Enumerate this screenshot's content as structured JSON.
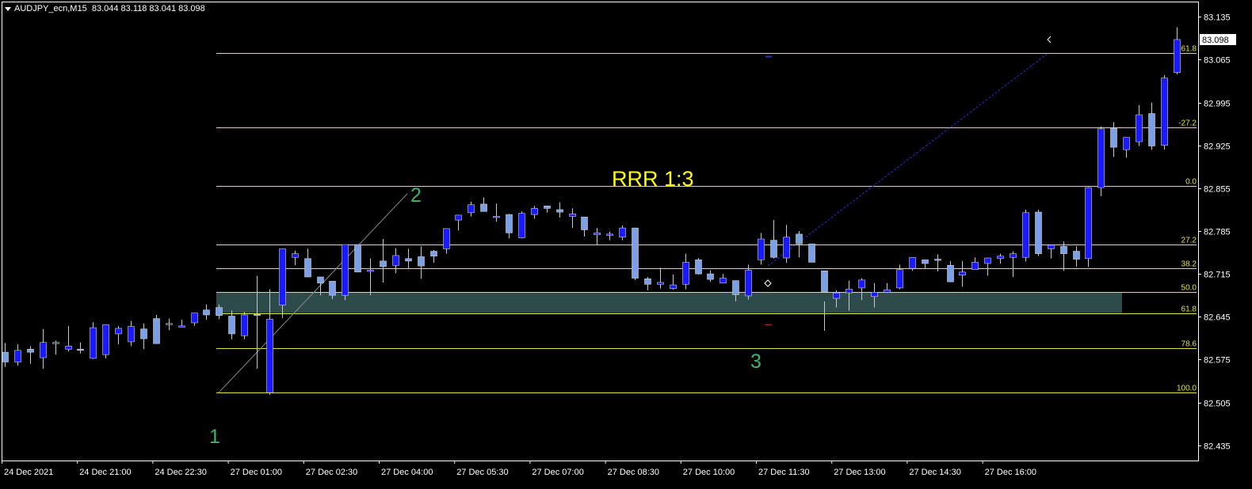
{
  "header": {
    "symbol": "AUDJPY_ecn,M15",
    "ohlc": "83.044 83.118 83.041 83.098"
  },
  "colors": {
    "background": "#000000",
    "frame": "#ffffff",
    "bull_candle": "#1a1aff",
    "bear_candle": "#7aa0e8",
    "fib_line": "#e6e632",
    "fib_label": "#e6e632",
    "zone_fill": "#2f4f4f",
    "wave_label": "#3cb371",
    "rrr_text": "#ffff00"
  },
  "annotations": {
    "rrr": "RRR 1:3",
    "wave_1": "1",
    "wave_2": "2",
    "wave_3": "3"
  },
  "chart_data": {
    "type": "candlestick",
    "symbol": "AUDJPY_ecn",
    "timeframe": "M15",
    "current_price": "83.098",
    "y_axis": {
      "ticks": [
        "83.135",
        "83.065",
        "82.995",
        "82.925",
        "82.855",
        "82.785",
        "82.715",
        "82.645",
        "82.575",
        "82.505",
        "82.435"
      ],
      "range": [
        82.41,
        83.16
      ]
    },
    "x_axis": {
      "ticks": [
        "24 Dec 2021",
        "24 Dec 21:00",
        "24 Dec 22:30",
        "27 Dec 01:00",
        "27 Dec 02:30",
        "27 Dec 04:00",
        "27 Dec 05:30",
        "27 Dec 07:00",
        "27 Dec 08:30",
        "27 Dec 10:00",
        "27 Dec 11:30",
        "27 Dec 13:00",
        "27 Dec 14:30",
        "27 Dec 16:00"
      ]
    },
    "fibonacci_levels": [
      {
        "label": "-61.8",
        "price": 83.076
      },
      {
        "label": "-27.2",
        "price": 82.955
      },
      {
        "label": "0.0",
        "price": 82.859
      },
      {
        "label": "27.2",
        "price": 82.763
      },
      {
        "label": "38.2",
        "price": 82.724
      },
      {
        "label": "50.0",
        "price": 82.685
      },
      {
        "label": "61.8",
        "price": 82.651
      },
      {
        "label": "78.6",
        "price": 82.594
      },
      {
        "label": "100.0",
        "price": 82.521
      }
    ],
    "zone": {
      "from": 82.651,
      "to": 82.685
    },
    "candles": [
      [
        82.587,
        82.602,
        82.563,
        82.571
      ],
      [
        82.571,
        82.6,
        82.565,
        82.59
      ],
      [
        82.592,
        82.597,
        82.568,
        82.587
      ],
      [
        82.578,
        82.625,
        82.56,
        82.603
      ],
      [
        82.603,
        82.606,
        82.583,
        82.603
      ],
      [
        82.592,
        82.63,
        82.588,
        82.597
      ],
      [
        82.592,
        82.603,
        82.585,
        82.59
      ],
      [
        82.577,
        82.636,
        82.576,
        82.627
      ],
      [
        82.583,
        82.631,
        82.577,
        82.632
      ],
      [
        82.617,
        82.63,
        82.6,
        82.626
      ],
      [
        82.604,
        82.638,
        82.597,
        82.629
      ],
      [
        82.625,
        82.634,
        82.592,
        82.609
      ],
      [
        82.642,
        82.648,
        82.601,
        82.601
      ],
      [
        82.634,
        82.642,
        82.623,
        82.634
      ],
      [
        82.63,
        82.64,
        82.628,
        82.63
      ],
      [
        82.635,
        82.651,
        82.63,
        82.651
      ],
      [
        82.656,
        82.665,
        82.64,
        82.648
      ],
      [
        82.66,
        82.665,
        82.641,
        82.647
      ],
      [
        82.646,
        82.655,
        82.608,
        82.617
      ],
      [
        82.614,
        82.653,
        82.608,
        82.648
      ],
      [
        82.649,
        82.712,
        82.56,
        82.648
      ],
      [
        82.521,
        82.69,
        82.517,
        82.641
      ],
      [
        82.664,
        82.752,
        82.643,
        82.756
      ],
      [
        82.742,
        82.753,
        82.729,
        82.748
      ],
      [
        82.74,
        82.756,
        82.71,
        82.71
      ],
      [
        82.71,
        82.706,
        82.68,
        82.7
      ],
      [
        82.703,
        82.702,
        82.674,
        82.68
      ],
      [
        82.68,
        82.723,
        82.672,
        82.763
      ],
      [
        82.763,
        82.763,
        82.737,
        82.718
      ],
      [
        82.72,
        82.74,
        82.68,
        82.721
      ],
      [
        82.736,
        82.772,
        82.701,
        82.727
      ],
      [
        82.729,
        82.757,
        82.716,
        82.745
      ],
      [
        82.74,
        82.756,
        82.723,
        82.736
      ],
      [
        82.743,
        82.76,
        82.707,
        82.728
      ],
      [
        82.752,
        82.754,
        82.733,
        82.744
      ],
      [
        82.756,
        82.777,
        82.748,
        82.789
      ],
      [
        82.803,
        82.81,
        82.786,
        82.811
      ],
      [
        82.815,
        82.833,
        82.809,
        82.828
      ],
      [
        82.829,
        82.84,
        82.818,
        82.817
      ],
      [
        82.809,
        82.83,
        82.8,
        82.809
      ],
      [
        82.812,
        82.813,
        82.773,
        82.782
      ],
      [
        82.774,
        82.817,
        82.773,
        82.814
      ],
      [
        82.812,
        82.826,
        82.805,
        82.822
      ],
      [
        82.826,
        82.826,
        82.815,
        82.822
      ],
      [
        82.82,
        82.832,
        82.807,
        82.816
      ],
      [
        82.809,
        82.822,
        82.79,
        82.813
      ],
      [
        82.808,
        82.805,
        82.776,
        82.787
      ],
      [
        82.779,
        82.79,
        82.762,
        82.782
      ],
      [
        82.778,
        82.784,
        82.77,
        82.78
      ],
      [
        82.775,
        82.794,
        82.77,
        82.79
      ],
      [
        82.79,
        82.789,
        82.705,
        82.708
      ],
      [
        82.707,
        82.71,
        82.688,
        82.698
      ],
      [
        82.698,
        82.725,
        82.691,
        82.701
      ],
      [
        82.691,
        82.714,
        82.689,
        82.697
      ],
      [
        82.698,
        82.748,
        82.69,
        82.734
      ],
      [
        82.738,
        82.741,
        82.714,
        82.715
      ],
      [
        82.715,
        82.721,
        82.702,
        82.706
      ],
      [
        82.7,
        82.715,
        82.703,
        82.708
      ],
      [
        82.704,
        82.698,
        82.67,
        82.681
      ],
      [
        82.679,
        82.73,
        82.673,
        82.721
      ],
      [
        82.738,
        82.782,
        82.73,
        82.772
      ],
      [
        82.77,
        82.803,
        82.74,
        82.742
      ],
      [
        82.741,
        82.795,
        82.733,
        82.775
      ],
      [
        82.78,
        82.785,
        82.742,
        82.764
      ],
      [
        82.764,
        82.76,
        82.75,
        82.734
      ],
      [
        82.72,
        82.67,
        82.622,
        82.686
      ],
      [
        82.675,
        82.688,
        82.66,
        82.684
      ],
      [
        82.684,
        82.704,
        82.655,
        82.69
      ],
      [
        82.692,
        82.708,
        82.672,
        82.705
      ],
      [
        82.678,
        82.7,
        82.66,
        82.685
      ],
      [
        82.685,
        82.7,
        82.684,
        82.689
      ],
      [
        82.692,
        82.73,
        82.69,
        82.722
      ],
      [
        82.724,
        82.742,
        82.72,
        82.742
      ],
      [
        82.738,
        82.737,
        82.723,
        82.732
      ],
      [
        82.739,
        82.747,
        82.719,
        82.738
      ],
      [
        82.729,
        82.736,
        82.708,
        82.702
      ],
      [
        82.713,
        82.736,
        82.694,
        82.718
      ],
      [
        82.722,
        82.742,
        82.722,
        82.734
      ],
      [
        82.732,
        82.741,
        82.712,
        82.741
      ],
      [
        82.74,
        82.748,
        82.732,
        82.744
      ],
      [
        82.742,
        82.752,
        82.71,
        82.748
      ],
      [
        82.742,
        82.82,
        82.735,
        82.815
      ],
      [
        82.816,
        82.82,
        82.744,
        82.748
      ],
      [
        82.756,
        82.756,
        82.74,
        82.762
      ],
      [
        82.76,
        82.768,
        82.72,
        82.748
      ],
      [
        82.752,
        82.76,
        82.727,
        82.739
      ],
      [
        82.74,
        82.857,
        82.726,
        82.856
      ],
      [
        82.856,
        82.956,
        82.842,
        82.952
      ],
      [
        82.953,
        82.963,
        82.906,
        82.922
      ],
      [
        82.918,
        82.933,
        82.905,
        82.938
      ],
      [
        82.931,
        82.991,
        82.924,
        82.975
      ],
      [
        82.977,
        82.995,
        82.918,
        82.924
      ],
      [
        82.925,
        83.04,
        82.918,
        83.035
      ],
      [
        83.044,
        83.118,
        83.041,
        83.098
      ]
    ]
  }
}
